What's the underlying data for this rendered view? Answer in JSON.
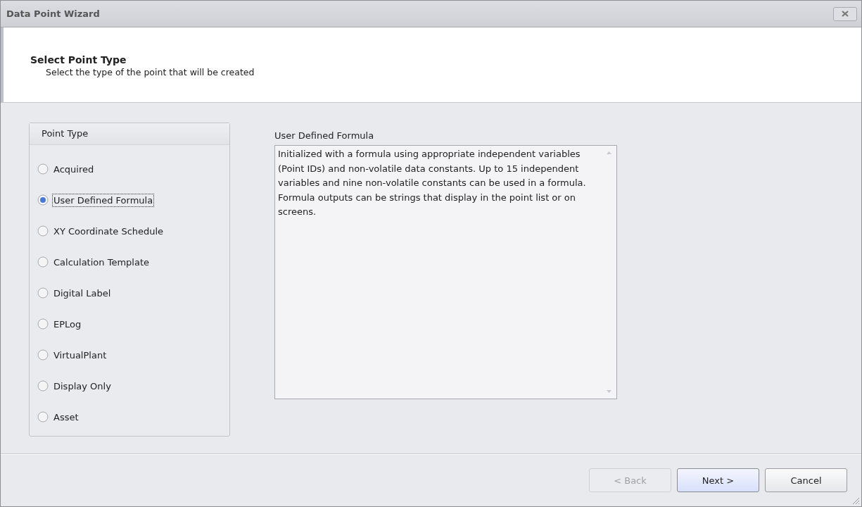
{
  "window": {
    "title": "Data Point Wizard"
  },
  "header": {
    "title": "Select Point Type",
    "subtitle": "Select the type of the point that will be created"
  },
  "point_type": {
    "title": "Point Type",
    "options": [
      {
        "label": "Acquired",
        "selected": false
      },
      {
        "label": "User Defined Formula",
        "selected": true
      },
      {
        "label": "XY Coordinate Schedule",
        "selected": false
      },
      {
        "label": "Calculation Template",
        "selected": false
      },
      {
        "label": "Digital Label",
        "selected": false
      },
      {
        "label": "EPLog",
        "selected": false
      },
      {
        "label": "VirtualPlant",
        "selected": false
      },
      {
        "label": "Display Only",
        "selected": false
      },
      {
        "label": "Asset",
        "selected": false
      }
    ]
  },
  "description": {
    "label": "User Defined Formula",
    "text": "Initialized with a formula using appropriate independent variables (Point IDs) and non-volatile data constants. Up to 15 independent variables and nine non-volatile constants can be used in a formula. Formula outputs can be strings that display in the point list or on screens."
  },
  "buttons": [
    {
      "label": "< Back",
      "disabled": true,
      "default": false
    },
    {
      "label": "Next >",
      "disabled": false,
      "default": true
    },
    {
      "label": "Cancel",
      "disabled": false,
      "default": false
    }
  ]
}
